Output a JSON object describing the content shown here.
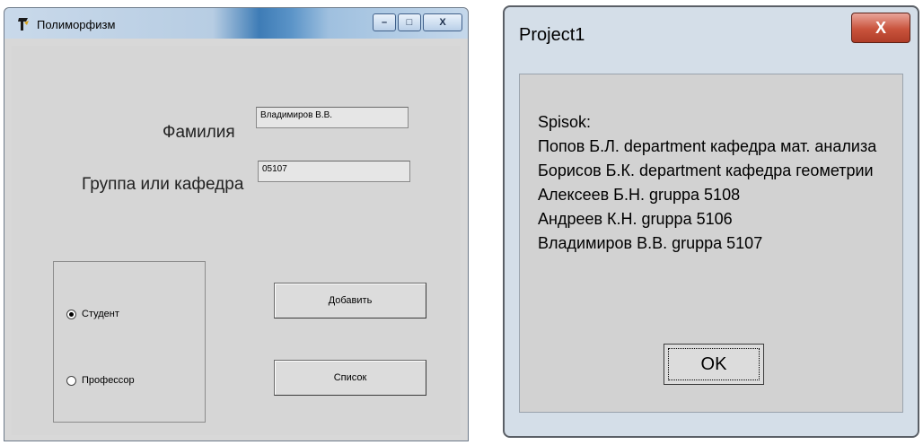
{
  "left_window": {
    "title": "Полиморфизм",
    "caption_buttons": {
      "minimize": "–",
      "maximize": "□",
      "close": "X"
    },
    "labels": {
      "surname": "Фамилия",
      "group": "Группа или кафедра"
    },
    "inputs": {
      "surname_value": "Владимиров В.В.",
      "group_value": "05107"
    },
    "radios": [
      {
        "label": "Студент",
        "checked": true
      },
      {
        "label": "Профессор",
        "checked": false
      }
    ],
    "buttons": {
      "add": "Добавить",
      "list": "Список"
    }
  },
  "right_window": {
    "title": "Project1",
    "close_label": "X",
    "message_lines": [
      "Spisok:",
      "Попов Б.Л. department кафедра мат. анализа",
      "Борисов Б.К. department кафедра геометрии",
      "Алексеев Б.Н. gruppa 5108",
      "Андреев К.Н. gruppa 5106",
      "Владимиров В.В. gruppa 5107"
    ],
    "ok_label": "OK"
  },
  "colors": {
    "close_button": "#c9533c",
    "window_border": "#5a5f66"
  }
}
